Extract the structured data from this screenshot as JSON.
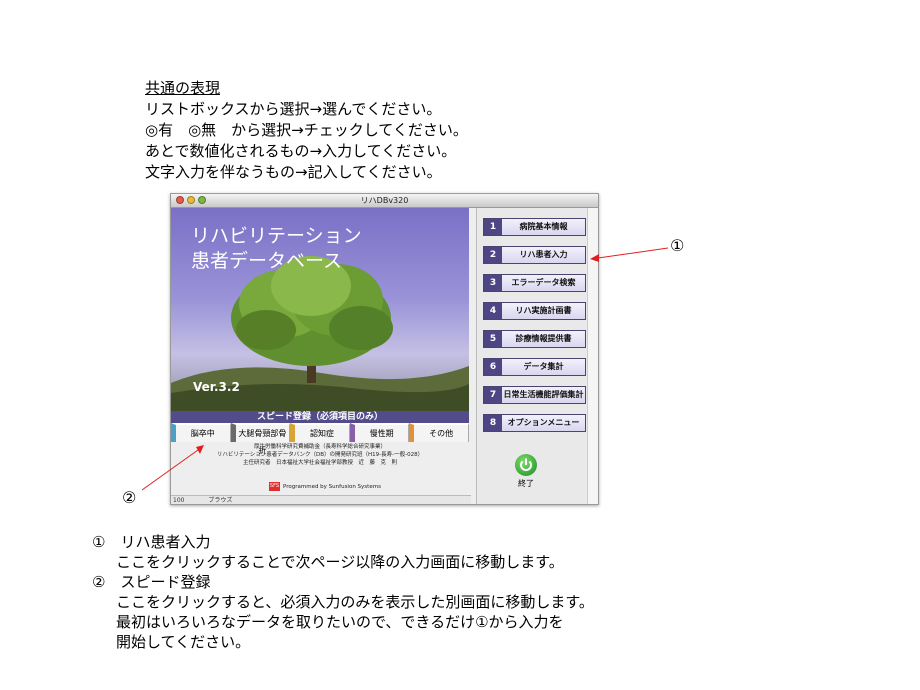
{
  "intro": {
    "heading": "共通の表現",
    "lines": [
      "リストボックスから選択→選んでください。",
      "◎有　◎無　から選択→チェックしてください。",
      "あとで数値化されるもの→入力してください。",
      "文字入力を伴なうもの→記入してください。"
    ]
  },
  "window": {
    "title": "リハDBv320",
    "hero_title_line1": "リハビリテーション",
    "hero_title_line2": "患者データベース",
    "version": "Ver.3.2",
    "speed_registration": "スピード登録（必須項目のみ）",
    "speed_buttons": [
      "脳卒中",
      "大腿骨頸部骨折",
      "認知症",
      "慢性期",
      "その他"
    ],
    "credits": [
      "厚生労働科学研究費補助金（長寿科学総合研究事業）",
      "リハビリテーション患者データバンク（DB）の開発研究班（H19-長寿-一般-028）",
      "主任研究者　日本福祉大学社会福祉学部教授　近　藤　克　則"
    ],
    "logo_text": "SFS",
    "programmed_by": "Programmed by Sunfusion Systems",
    "status": "100",
    "status_mode": "ブラウズ",
    "menu": [
      {
        "num": "1",
        "label": "病院基本情報"
      },
      {
        "num": "2",
        "label": "リハ患者入力"
      },
      {
        "num": "3",
        "label": "エラーデータ検索"
      },
      {
        "num": "4",
        "label": "リハ実施計画書"
      },
      {
        "num": "5",
        "label": "診療情報提供書"
      },
      {
        "num": "6",
        "label": "データ集計"
      },
      {
        "num": "7",
        "label": "日常生活機能評価集計"
      },
      {
        "num": "8",
        "label": "オプションメニュー"
      }
    ],
    "exit_label": "終了"
  },
  "markers": {
    "one": "①",
    "two": "②"
  },
  "notes": {
    "item1_title": "①　リハ患者入力",
    "item1_desc": "ここをクリックすることで次ページ以降の入力画面に移動します。",
    "item2_title": "②　スピード登録",
    "item2_desc1": "ここをクリックすると、必須入力のみを表示した別画面に移動します。",
    "item2_desc2": "最初はいろいろなデータを取りたいので、できるだけ①から入力を",
    "item2_desc3": "開始してください。"
  },
  "colors": {
    "arrow": "#e02020",
    "menu_number": "#4e4684",
    "hero_sky": "#7b70c6"
  }
}
